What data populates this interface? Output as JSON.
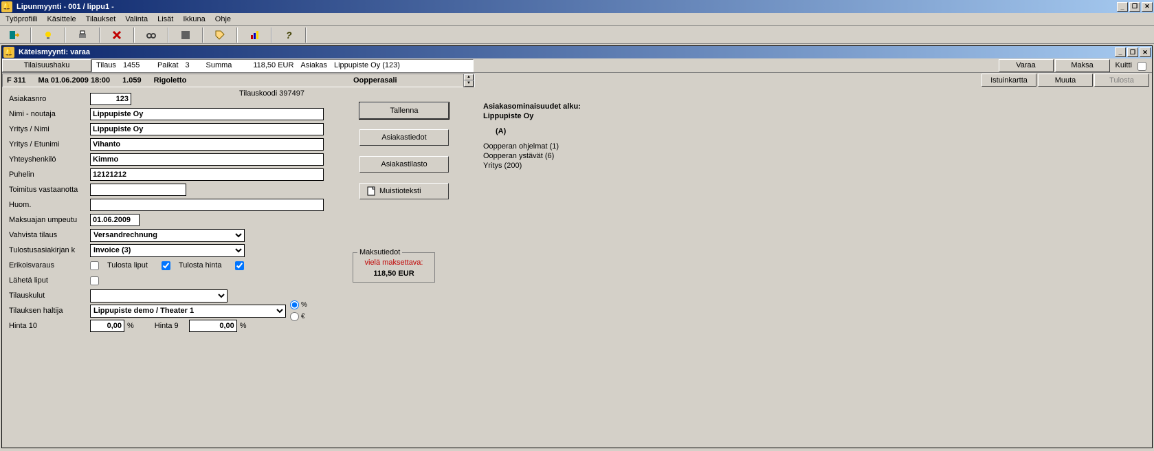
{
  "window": {
    "outer_title": "Lipunmyynti  - 001 / lippu1 -",
    "inner_title": "Käteismyynti: varaa"
  },
  "menu": [
    "Työprofiili",
    "Käsittele",
    "Tilaukset",
    "Valinta",
    "Lisät",
    "Ikkuna",
    "Ohje"
  ],
  "toolbar_icons": [
    "exit",
    "lightbulb",
    "print",
    "delete",
    "binoculars",
    "disabled-box",
    "tag",
    "report",
    "help"
  ],
  "infobar": {
    "haku_btn": "Tilaisuushaku",
    "tilaus_lbl": "Tilaus",
    "tilaus_val": "1455",
    "paikat_lbl": "Paikat",
    "paikat_val": "3",
    "summa_lbl": "Summa",
    "summa_val": "118,50 EUR",
    "asiakas_lbl": "Asiakas",
    "asiakas_val": "Lippupiste Oy (123)",
    "varaa": "Varaa",
    "maksa": "Maksa",
    "kuitti": "Kuitti"
  },
  "event": {
    "code": "F 311",
    "datetime": "Ma 01.06.2009 18:00",
    "num": "1.059",
    "name": "Rigoletto",
    "hall": "Oopperasali",
    "istuinkartta": "Istuinkartta",
    "muuta": "Muuta",
    "tulosta": "Tulosta"
  },
  "form": {
    "tilauskoodi_lbl": "Tilauskoodi",
    "tilauskoodi_val": "397497",
    "asiakasnro_lbl": "Asiakasnro",
    "asiakasnro_val": "123",
    "nimi_lbl": "Nimi - noutaja",
    "nimi_val": "Lippupiste Oy",
    "yritys_nimi_lbl": "Yritys / Nimi",
    "yritys_nimi_val": "Lippupiste Oy",
    "yritys_etu_lbl": "Yritys / Etunimi",
    "yritys_etu_val": "Vihanto",
    "yhteys_lbl": "Yhteyshenkilö",
    "yhteys_val": "Kimmo",
    "puhelin_lbl": "Puhelin",
    "puhelin_val": "12121212",
    "toimitus_lbl": "Toimitus vastaanotta",
    "toimitus_val": "",
    "huom_lbl": "Huom.",
    "huom_val": "",
    "maksu_lbl": "Maksuajan umpeutu",
    "maksu_val": "01.06.2009",
    "vahvista_lbl": "Vahvista tilaus",
    "vahvista_val": "Versandrechnung",
    "tulostus_lbl": "Tulostusasiakirjan k",
    "tulostus_val": "Invoice (3)",
    "erikois_lbl": "Erikoisvaraus",
    "tulosta_liput": "Tulosta liput",
    "tulosta_hinta": "Tulosta hinta",
    "laheta_lbl": "Lähetä liput",
    "tilauskulut_lbl": "Tilauskulut",
    "haltija_lbl": "Tilauksen haltija",
    "haltija_val": "Lippupiste demo / Theater 1",
    "hinta10_lbl": "Hinta 10",
    "hinta10_val": "0,00",
    "hinta9_lbl": "Hinta 9",
    "hinta9_val": "0,00",
    "pct": "%",
    "eur": "€"
  },
  "mid_buttons": {
    "tallenna": "Tallenna",
    "asiakastiedot": "Asiakastiedot",
    "asiakastilasto": "Asiakastilasto",
    "muistioteksti": "Muistioteksti"
  },
  "customer_attrs": {
    "header": "Asiakasominaisuudet alku:",
    "name": "Lippupiste Oy",
    "code": "(A)",
    "lines": [
      "Oopperan ohjelmat (1)",
      "Oopperan ystävät (6)",
      "Yritys (200)"
    ]
  },
  "payment": {
    "legend": "Maksutiedot",
    "outstanding_lbl": "vielä maksettava:",
    "amount": "118,50 EUR"
  }
}
